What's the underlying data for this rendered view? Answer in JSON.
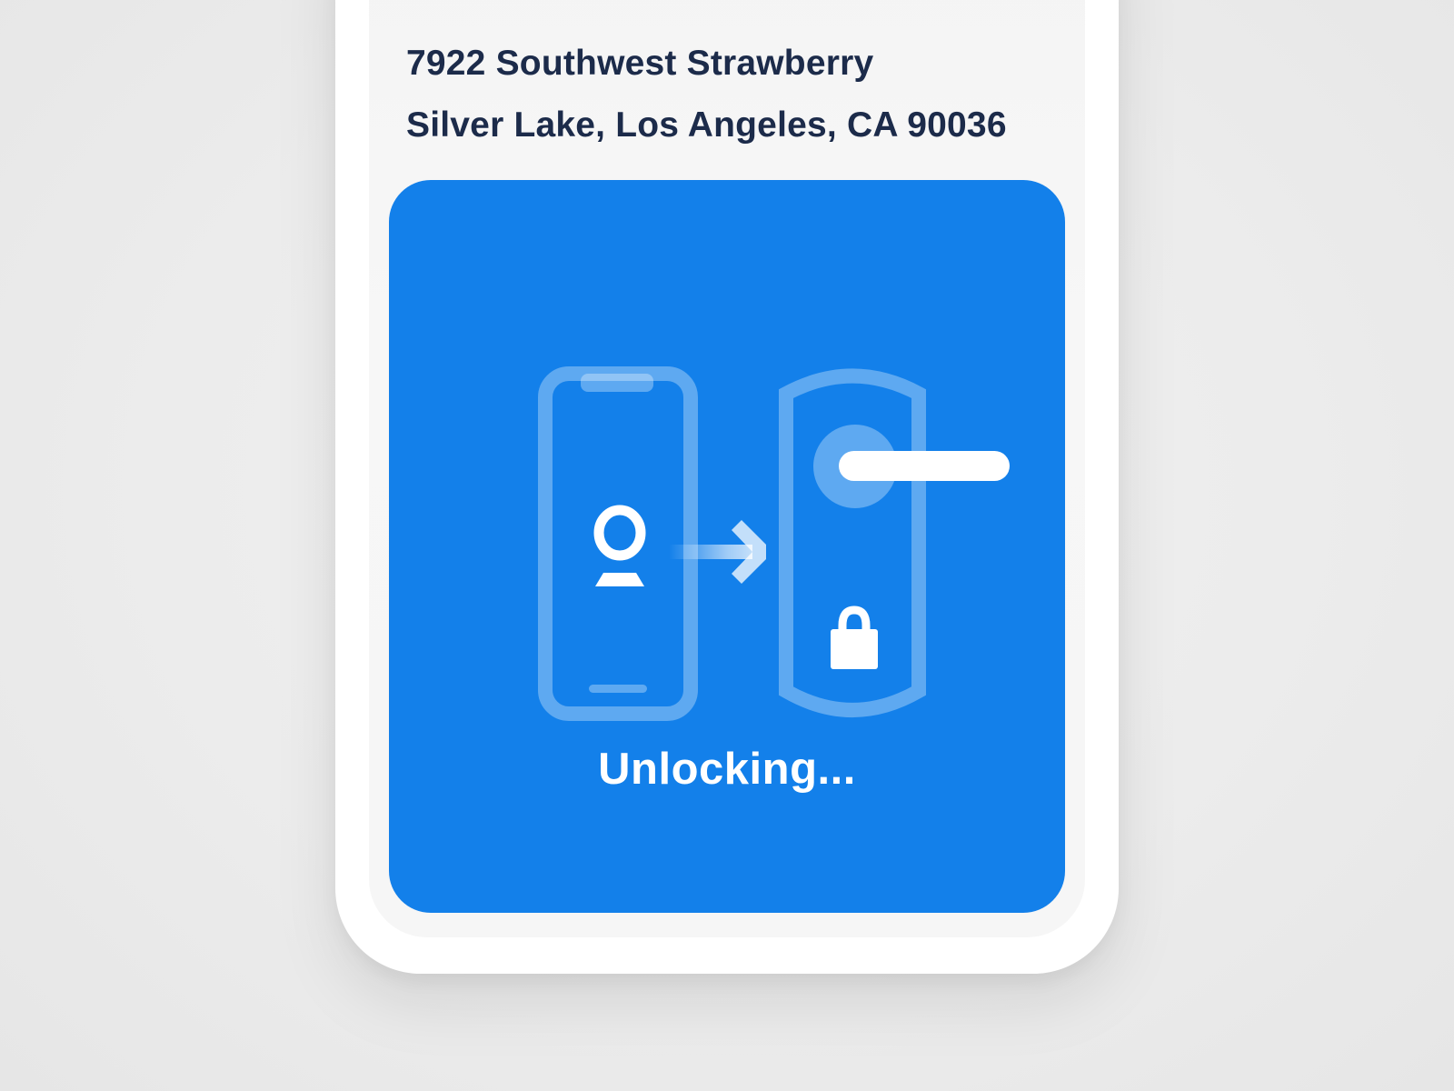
{
  "property": {
    "address_line1": "7922 Southwest Strawberry",
    "address_line2": "Silver Lake, Los Angeles, CA 90036"
  },
  "unlock_card": {
    "status": "Unlocking...",
    "accent_color": "#1380ea",
    "icons": [
      "phone-icon",
      "app-logo-icon",
      "arrow-right-icon",
      "door-lock-icon",
      "door-handle-icon",
      "padlock-icon"
    ]
  },
  "colors": {
    "address_text": "#1c2b4a",
    "background": "#ededed"
  }
}
